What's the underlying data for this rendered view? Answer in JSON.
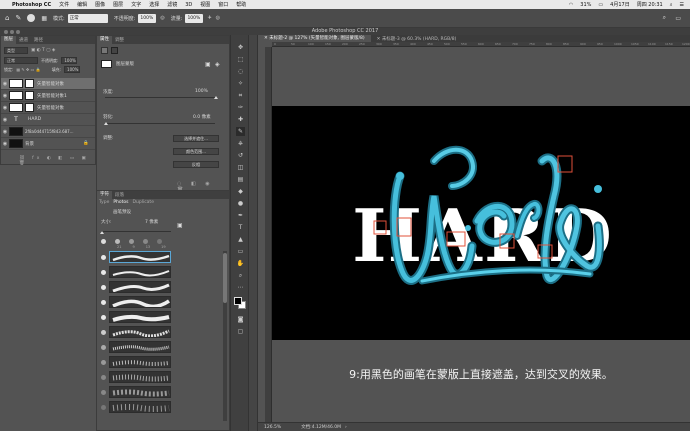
{
  "menubar": {
    "app_name": "Photoshop CC",
    "items": [
      "文件",
      "编辑",
      "图像",
      "图层",
      "文字",
      "选择",
      "滤镜",
      "3D",
      "视图",
      "窗口",
      "帮助"
    ],
    "battery": "31%",
    "clock": "周四 20:31",
    "date": "4月17日"
  },
  "options_bar": {
    "mode_label": "模式:",
    "mode_value": "正常",
    "opacity_label": "不透明度:",
    "opacity_value": "100%",
    "flow_label": "流量:",
    "flow_value": "100%"
  },
  "app_title": "Adobe Photoshop CC 2017",
  "layers_panel": {
    "tabs": [
      "图层",
      "通道",
      "路径"
    ],
    "filter_kind": "类型",
    "blend_mode": "正常",
    "opacity_label": "不透明度:",
    "opacity_value": "100%",
    "lock_label": "锁定:",
    "fill_label": "填充:",
    "fill_value": "100%",
    "layers": [
      {
        "name": "矢量智能对象",
        "type": "smart",
        "selected": true
      },
      {
        "name": "矢量智能对象1",
        "type": "smart",
        "selected": false
      },
      {
        "name": "矢量智能对象",
        "type": "smart",
        "selected": false
      },
      {
        "name": "HARD",
        "type": "text",
        "selected": false
      },
      {
        "name": "2f8a0d44715f843.687...",
        "type": "image",
        "selected": false
      },
      {
        "name": "背景",
        "type": "background",
        "selected": false
      }
    ]
  },
  "properties_panel": {
    "tabs": [
      "属性",
      "调整"
    ],
    "header": "图层蒙版",
    "density_label": "浓度:",
    "density_value": "100%",
    "feather_label": "羽化:",
    "feather_value": "0.0 像素",
    "refine_label": "调整:",
    "buttons": [
      "选择并遮住...",
      "颜色范围...",
      "反相"
    ]
  },
  "brush_panel": {
    "tabs": [
      "字符",
      "段落"
    ],
    "subtabs": [
      "Type",
      "Photos",
      "Duplicate"
    ],
    "section_title": "画笔预设",
    "size_label": "大小:",
    "size_value": "7 像素",
    "presets_numbers": [
      "21",
      "9",
      "13",
      "19"
    ]
  },
  "document": {
    "tabs": [
      "未标题-2 @ 127% (矢量智能对象, 图层蒙版/8)",
      "未标题-3 @ 60.3% (HARD, RGB/8)"
    ],
    "ruler_marks": [
      "0",
      "50",
      "100",
      "150",
      "200",
      "250",
      "300",
      "350",
      "400",
      "450",
      "500",
      "550",
      "600",
      "650",
      "700",
      "750",
      "800",
      "850",
      "900",
      "950",
      "1000",
      "1050",
      "1100",
      "1150",
      "1200"
    ],
    "canvas_text_white": "HARD",
    "canvas_text_script": "Work",
    "status_zoom": "126.5%",
    "status_doc": "文档:4.12M/46.0M"
  },
  "caption": "9:用黑色的画笔在蒙版上直接遮盖，达到交叉的效果。",
  "colors": {
    "ui_bg": "#535353",
    "canvas_bg": "#000000",
    "tube_color": "#3fb8d6",
    "mask_marker": "#e0503a"
  }
}
